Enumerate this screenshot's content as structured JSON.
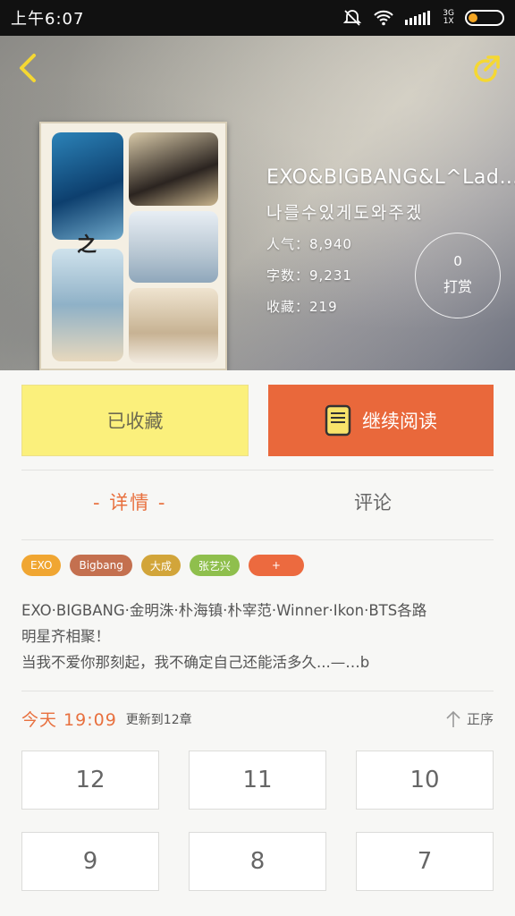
{
  "status_bar": {
    "time": "上午6:07",
    "network_label": "3G\n1X"
  },
  "book": {
    "title": "EXO&BIGBANG&L^Lad…",
    "subtitle": "나를수있게도와주겠",
    "popularity": "人气：8,940",
    "word_count": "字数：9,231",
    "favorites": "收藏：219",
    "tip_count": "0",
    "tip_label": "打赏",
    "cover_letter": "之"
  },
  "actions": {
    "favorited_label": "已收藏",
    "continue_label": "继续阅读"
  },
  "tabs": {
    "details": "- 详情 -",
    "comments": "评论"
  },
  "tags": [
    {
      "label": "EXO",
      "color": "#f0a632"
    },
    {
      "label": "Bigbang",
      "color": "#c4704f"
    },
    {
      "label": "大成",
      "color": "#d2a53a"
    },
    {
      "label": "张艺兴",
      "color": "#8fbf4d"
    },
    {
      "label": "+",
      "color": "#ec6a3f"
    }
  ],
  "description": [
    "EXO·BIGBANG·金明洙·朴海镇·朴宰范·Winner·Ikon·BTS各路",
    "明星齐相聚！",
    "当我不爱你那刻起，我不确定自己还能活多久...—…b"
  ],
  "update": {
    "time": "今天 19:09",
    "text": "更新到12章",
    "sort_label": "正序"
  },
  "chapters": [
    "12",
    "11",
    "10",
    "9",
    "8",
    "7"
  ],
  "colors": {
    "accent": "#e8703e",
    "favorite_button": "#fbf07c",
    "read_button": "#e9683b"
  }
}
